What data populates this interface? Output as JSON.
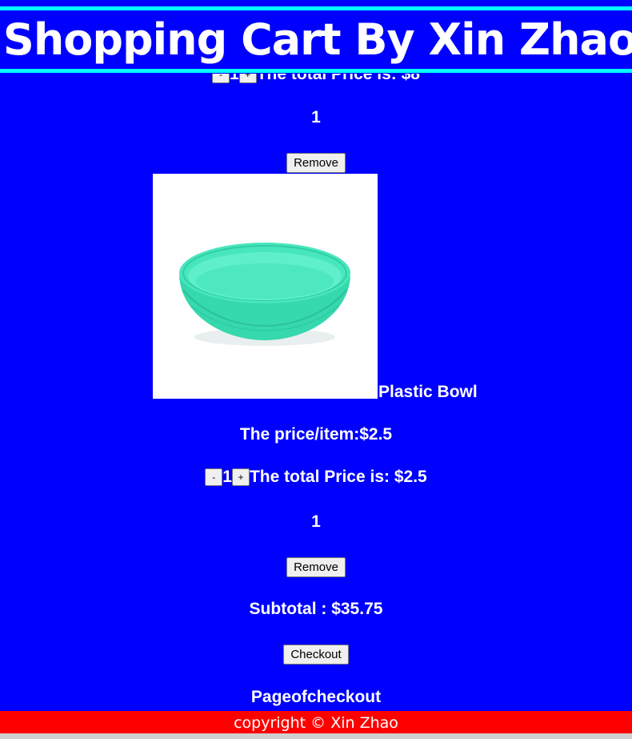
{
  "header": {
    "title": "Shopping Cart By Xin Zhao"
  },
  "cart_items": [
    {
      "name": "",
      "price_per_item": "",
      "qty_decrement_label": "-",
      "quantity": "1",
      "qty_increment_label": "+",
      "total_price_text": "The total Price is: $8",
      "count": "1",
      "remove_label": "Remove"
    },
    {
      "name": "Plastic Bowl",
      "image_alt": "Plastic Bowl",
      "price_per_item": "The price/item:$2.5",
      "qty_decrement_label": "-",
      "quantity": "1",
      "qty_increment_label": "+",
      "total_price_text": "The total Price is: $2.5",
      "count": "1",
      "remove_label": "Remove"
    }
  ],
  "summary": {
    "subtotal_text": "Subtotal : $35.75",
    "checkout_label": "Checkout",
    "checkout_page_link": "Pageofcheckout"
  },
  "footer": {
    "copyright": "copyright © Xin Zhao"
  },
  "colors": {
    "background": "#0000ff",
    "header_rule": "#00ffff",
    "footer": "#ff0000",
    "bowl": "#3ee0b4"
  }
}
